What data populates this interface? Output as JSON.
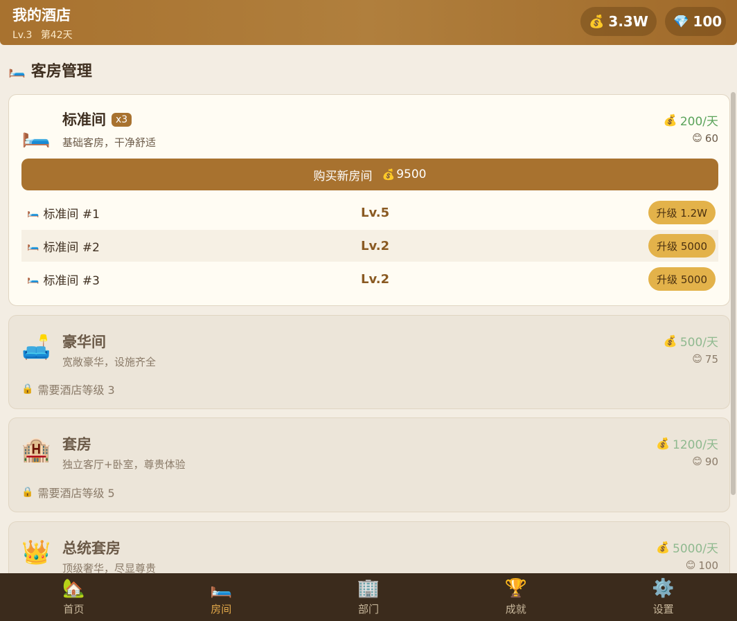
{
  "header": {
    "title": "我的酒店",
    "level": "Lv.3",
    "day": "第42天",
    "gold": "3.3W",
    "gems": "100",
    "gold_icon": "💰",
    "gem_icon": "💎"
  },
  "section": {
    "title": "客房管理",
    "icon": "🛏️"
  },
  "rooms": [
    {
      "icon": "🛏️",
      "name": "标准间",
      "count": "x3",
      "desc": "基础客房，干净舒适",
      "income": "200/天",
      "happiness": "60",
      "buy_label": "购买新房间",
      "buy_cost": "9500",
      "units": [
        {
          "name": "标准间 #1",
          "level": "Lv.5",
          "upgrade": "升级 1.2W"
        },
        {
          "name": "标准间 #2",
          "level": "Lv.2",
          "upgrade": "升级 5000"
        },
        {
          "name": "标准间 #3",
          "level": "Lv.2",
          "upgrade": "升级 5000"
        }
      ]
    },
    {
      "icon": "🛋️",
      "name": "豪华间",
      "desc": "宽敞豪华，设施齐全",
      "income": "500/天",
      "happiness": "75",
      "lock": "需要酒店等级 3"
    },
    {
      "icon": "🏨",
      "name": "套房",
      "desc": "独立客厅+卧室，尊贵体验",
      "income": "1200/天",
      "happiness": "90",
      "lock": "需要酒店等级 5"
    },
    {
      "icon": "👑",
      "name": "总统套房",
      "desc": "顶级奢华，尽显尊贵",
      "income": "5000/天",
      "happiness": "100"
    }
  ],
  "icons": {
    "money": "💰",
    "smile": "😊",
    "lock": "🔒",
    "bed": "🛏️"
  },
  "nav": [
    {
      "label": "首页",
      "icon": "🏡"
    },
    {
      "label": "房间",
      "icon": "🛏️"
    },
    {
      "label": "部门",
      "icon": "🏢"
    },
    {
      "label": "成就",
      "icon": "🏆"
    },
    {
      "label": "设置",
      "icon": "⚙️"
    }
  ],
  "colors": {
    "header": "#a8722f",
    "accent": "#a8722f",
    "upgrade": "#e3b24a",
    "income": "#5aa35a",
    "nav_bg": "#3b2b1c",
    "nav_active": "#e3a94a"
  }
}
